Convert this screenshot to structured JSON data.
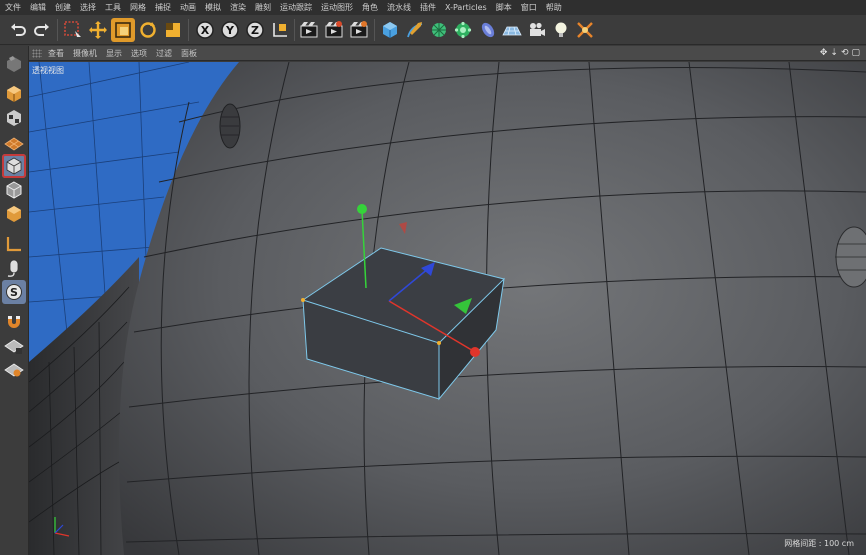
{
  "menu": [
    "文件",
    "编辑",
    "创建",
    "选择",
    "工具",
    "网格",
    "捕捉",
    "动画",
    "模拟",
    "渲染",
    "雕刻",
    "运动跟踪",
    "运动图形",
    "角色",
    "流水线",
    "插件",
    "X-Particles",
    "脚本",
    "窗口",
    "帮助"
  ],
  "viewport": {
    "menu": [
      "查看",
      "摄像机",
      "显示",
      "选项",
      "过滤",
      "面板"
    ],
    "label": "透视视图",
    "grid_readout": "网格间距 : 100 cm",
    "nav_icons": [
      "✥",
      "⇣",
      "⟲",
      "▢"
    ]
  },
  "axis_labels": {
    "x": "X",
    "y": "Y",
    "z": "Z"
  },
  "colors": {
    "accent_selected": "#6b80a3",
    "axis_x": "#e0352b",
    "axis_y": "#35d33a",
    "axis_z": "#2f48d8",
    "background_blue": "#2f6bc4"
  }
}
